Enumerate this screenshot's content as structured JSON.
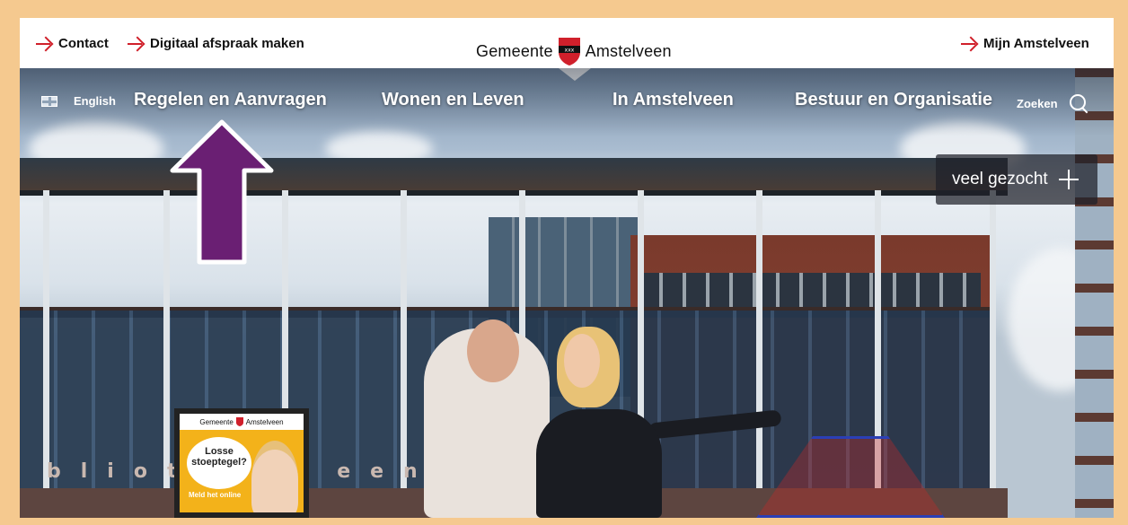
{
  "topbar": {
    "links_left": [
      {
        "label": "Contact",
        "icon": "arrow-right-icon"
      },
      {
        "label": "Digitaal afspraak maken",
        "icon": "arrow-right-icon"
      }
    ],
    "logo": {
      "left": "Gemeente",
      "right": "Amstelveen"
    },
    "link_right": {
      "label": "Mijn Amstelveen",
      "icon": "arrow-right-icon"
    }
  },
  "nav": {
    "language": "English",
    "items": [
      {
        "label": "Regelen en Aanvragen"
      },
      {
        "label": "Wonen en Leven"
      },
      {
        "label": "In Amstelveen"
      },
      {
        "label": "Bestuur en Organisatie"
      }
    ],
    "search_label": "Zoeken"
  },
  "quick": {
    "label": "veel gezocht"
  },
  "hero_sign": "bliot  -  k  een",
  "poster": {
    "header_left": "Gemeente",
    "header_right": "Amstelveen",
    "bubble": "Losse stoeptegel?",
    "footer": "Meld het online"
  },
  "colors": {
    "accent": "#d0202b",
    "annotation": "#6a1f73",
    "frame": "#f5c98f"
  }
}
